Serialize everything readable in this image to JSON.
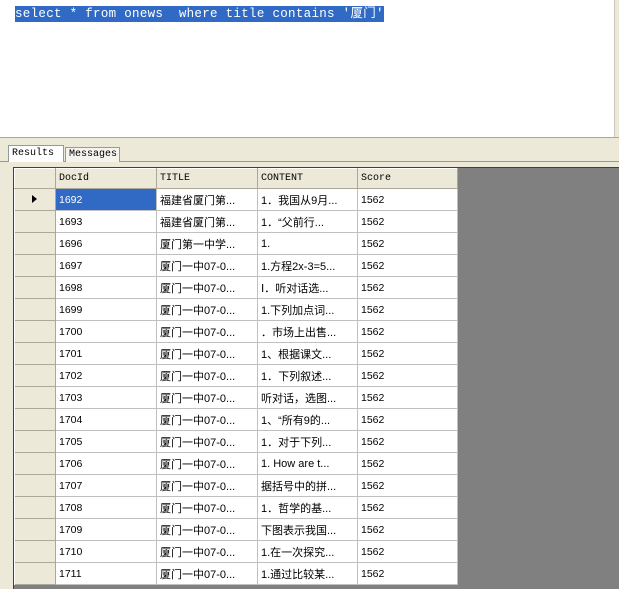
{
  "editor": {
    "query_text": "select * from onews  where title contains '厦门'"
  },
  "tabs": [
    {
      "label": "Results",
      "active": true
    },
    {
      "label": "Messages",
      "active": false
    }
  ],
  "grid": {
    "columns": [
      "DocId",
      "TITLE",
      "CONTENT",
      "Score"
    ],
    "selected_row": 0,
    "rows": [
      [
        "1692",
        "福建省厦门第...",
        "1．我国从9月...",
        "1562"
      ],
      [
        "1693",
        "福建省厦门第...",
        "1．“父前行...",
        "1562"
      ],
      [
        "1696",
        "厦门第一中学...",
        "1.",
        "1562"
      ],
      [
        "1697",
        "厦门一中07-0...",
        "1.方程2x-3=5...",
        "1562"
      ],
      [
        "1698",
        "厦门一中07-0...",
        "Ⅰ．听对话选...",
        "1562"
      ],
      [
        "1699",
        "厦门一中07-0...",
        "1.下列加点词...",
        "1562"
      ],
      [
        "1700",
        "厦门一中07-0...",
        "．市场上出售...",
        "1562"
      ],
      [
        "1701",
        "厦门一中07-0...",
        "1、根据课文...",
        "1562"
      ],
      [
        "1702",
        "厦门一中07-0...",
        "1．下列叙述...",
        "1562"
      ],
      [
        "1703",
        "厦门一中07-0...",
        "听对话，选图...",
        "1562"
      ],
      [
        "1704",
        "厦门一中07-0...",
        "1、“所有9的...",
        "1562"
      ],
      [
        "1705",
        "厦门一中07-0...",
        "1．对于下列...",
        "1562"
      ],
      [
        "1706",
        "厦门一中07-0...",
        "1. How are t...",
        "1562"
      ],
      [
        "1707",
        "厦门一中07-0...",
        "据括号中的拼...",
        "1562"
      ],
      [
        "1708",
        "厦门一中07-0...",
        "1．哲学的基...",
        "1562"
      ],
      [
        "1709",
        "厦门一中07-0...",
        "下图表示我国...",
        "1562"
      ],
      [
        "1710",
        "厦门一中07-0...",
        "1.在一次探究...",
        "1562"
      ],
      [
        "1711",
        "厦门一中07-0...",
        "1.通过比较某...",
        "1562"
      ]
    ]
  }
}
